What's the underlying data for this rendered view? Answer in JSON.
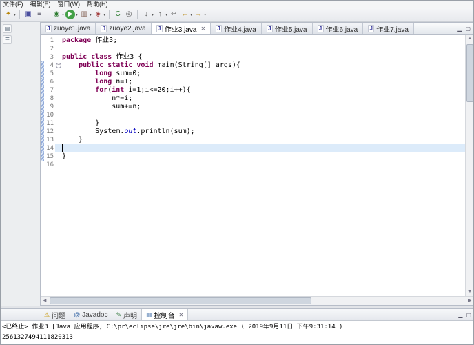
{
  "menubar": {
    "items": [
      "文件(F)",
      "编辑(E)",
      "窗口(W)",
      "帮助(H)"
    ]
  },
  "icons": {
    "dropdown": "▾",
    "close": "✕",
    "java": "J",
    "minimize": "▁",
    "maximize": "▢",
    "arrow_up": "▲",
    "arrow_down": "▼",
    "arrow_left": "◀",
    "arrow_right": "▶"
  },
  "toolbar": {
    "buttons": [
      {
        "name": "new-button",
        "icon": "new-wizard-icon",
        "glyph": "✦",
        "color": "#b8860b",
        "dropdown": true
      },
      {
        "sep": true
      },
      {
        "name": "save-button",
        "icon": "save-icon",
        "glyph": "▣",
        "color": "#4a4e9e"
      },
      {
        "name": "print-button",
        "icon": "print-icon",
        "glyph": "≡",
        "color": "#556"
      },
      {
        "sep": true
      },
      {
        "name": "debug-button",
        "icon": "debug-icon",
        "glyph": "◉",
        "color": "#2e7d32",
        "dropdown": true
      },
      {
        "name": "run-button",
        "icon": "run-icon",
        "glyph": "▶",
        "color": "#ffffff",
        "bg": "#43a047",
        "round": true,
        "dropdown": true
      },
      {
        "name": "coverage-button",
        "icon": "coverage-icon",
        "glyph": "▥",
        "color": "#8d6e63",
        "dropdown": true
      },
      {
        "name": "external-tools-button",
        "icon": "external-tools-icon",
        "glyph": "◈",
        "color": "#a23b3b",
        "dropdown": true
      },
      {
        "sep": true
      },
      {
        "name": "new-java-class-button",
        "icon": "new-class-icon",
        "glyph": "C",
        "color": "#2e7d32"
      },
      {
        "name": "search-button",
        "icon": "search-icon",
        "glyph": "◎",
        "color": "#555"
      },
      {
        "sep": true
      },
      {
        "name": "next-annotation-button",
        "icon": "arrow-down-icon",
        "glyph": "↓",
        "color": "#666",
        "dropdown": true
      },
      {
        "name": "previous-annotation-button",
        "icon": "arrow-up-icon",
        "glyph": "↑",
        "color": "#666",
        "dropdown": true
      },
      {
        "name": "last-edit-location-button",
        "icon": "last-edit-icon",
        "glyph": "↩",
        "color": "#666"
      },
      {
        "name": "back-button",
        "icon": "back-arrow-icon",
        "glyph": "←",
        "color": "#b8860b",
        "dropdown": true
      },
      {
        "name": "forward-button",
        "icon": "forward-arrow-icon",
        "glyph": "→",
        "color": "#b8860b",
        "dropdown": true
      }
    ]
  },
  "rail": {
    "icons": [
      {
        "name": "restore-view-button",
        "glyph": "▤"
      },
      {
        "name": "view-list-button",
        "glyph": "☰"
      }
    ]
  },
  "tabs": [
    {
      "label": "zuoye1.java",
      "active": false
    },
    {
      "label": "zuoye2.java",
      "active": false
    },
    {
      "label": "作业3.java",
      "active": true
    },
    {
      "label": "作业4.java",
      "active": false
    },
    {
      "label": "作业5.java",
      "active": false
    },
    {
      "label": "作业6.java",
      "active": false
    },
    {
      "label": "作业7.java",
      "active": false
    }
  ],
  "editor": {
    "current_line": 14,
    "changed_lines": [
      4,
      5,
      6,
      7,
      8,
      9,
      10,
      11,
      12,
      13,
      14,
      15
    ],
    "fold_lines": [
      4
    ],
    "lines": [
      {
        "num": 1,
        "seg": [
          {
            "s": "k",
            "t": "package"
          },
          {
            "s": "p",
            "t": " 作业3;"
          }
        ]
      },
      {
        "num": 2,
        "seg": []
      },
      {
        "num": 3,
        "seg": [
          {
            "s": "k",
            "t": "public"
          },
          {
            "s": "p",
            "t": " "
          },
          {
            "s": "k",
            "t": "class"
          },
          {
            "s": "p",
            "t": " 作业3 {"
          }
        ]
      },
      {
        "num": 4,
        "seg": [
          {
            "s": "p",
            "t": "    "
          },
          {
            "s": "k",
            "t": "public"
          },
          {
            "s": "p",
            "t": " "
          },
          {
            "s": "k",
            "t": "static"
          },
          {
            "s": "p",
            "t": " "
          },
          {
            "s": "k",
            "t": "void"
          },
          {
            "s": "p",
            "t": " main(String[] args){"
          }
        ]
      },
      {
        "num": 5,
        "seg": [
          {
            "s": "p",
            "t": "        "
          },
          {
            "s": "k",
            "t": "long"
          },
          {
            "s": "p",
            "t": " sum=0;"
          }
        ]
      },
      {
        "num": 6,
        "seg": [
          {
            "s": "p",
            "t": "        "
          },
          {
            "s": "k",
            "t": "long"
          },
          {
            "s": "p",
            "t": " n=1;"
          }
        ]
      },
      {
        "num": 7,
        "seg": [
          {
            "s": "p",
            "t": "        "
          },
          {
            "s": "k",
            "t": "for"
          },
          {
            "s": "p",
            "t": "("
          },
          {
            "s": "k",
            "t": "int"
          },
          {
            "s": "p",
            "t": " i=1;i<=20;i++){"
          }
        ]
      },
      {
        "num": 8,
        "seg": [
          {
            "s": "p",
            "t": "            n*=i;"
          }
        ]
      },
      {
        "num": 9,
        "seg": [
          {
            "s": "p",
            "t": "            sum+=n;"
          }
        ]
      },
      {
        "num": 10,
        "seg": []
      },
      {
        "num": 11,
        "seg": [
          {
            "s": "p",
            "t": "        }"
          }
        ]
      },
      {
        "num": 12,
        "seg": [
          {
            "s": "p",
            "t": "        System."
          },
          {
            "s": "f",
            "t": "out"
          },
          {
            "s": "p",
            "t": ".println(sum);"
          }
        ]
      },
      {
        "num": 13,
        "seg": [
          {
            "s": "p",
            "t": "    }"
          }
        ]
      },
      {
        "num": 14,
        "seg": []
      },
      {
        "num": 15,
        "seg": [
          {
            "s": "p",
            "t": "}"
          }
        ]
      },
      {
        "num": 16,
        "seg": []
      }
    ]
  },
  "console": {
    "tabs": [
      {
        "id": "problems",
        "label": "问题",
        "glyph": "⚠",
        "color": "#c69500",
        "icon": "problems-icon",
        "active": false
      },
      {
        "id": "javadoc",
        "label": "Javadoc",
        "glyph": "@",
        "color": "#3465a4",
        "icon": "javadoc-icon",
        "active": false
      },
      {
        "id": "declaration",
        "label": "声明",
        "glyph": "✎",
        "color": "#3a7d44",
        "icon": "declaration-icon",
        "active": false
      },
      {
        "id": "console",
        "label": "控制台",
        "glyph": "▥",
        "color": "#3465a4",
        "icon": "console-icon",
        "active": true
      }
    ],
    "lines": [
      "<已终止> 作业3 [Java 应用程序] C:\\pr\\eclipse\\jre\\jre\\bin\\javaw.exe ( 2019年9月11日 下午9:31:14 )",
      "2561327494111820313"
    ]
  }
}
